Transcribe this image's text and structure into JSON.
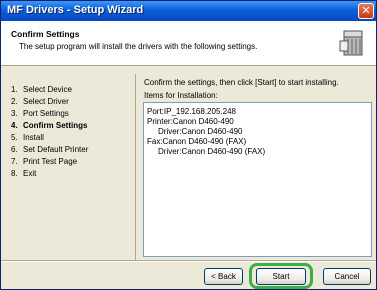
{
  "window": {
    "title": "MF Drivers - Setup Wizard"
  },
  "header": {
    "title": "Confirm Settings",
    "subtitle": "The setup program will install the drivers with the following settings.",
    "icon": "installer-box-icon"
  },
  "steps": [
    {
      "num": "1.",
      "label": "Select Device",
      "active": false
    },
    {
      "num": "2.",
      "label": "Select Driver",
      "active": false
    },
    {
      "num": "3.",
      "label": "Port Settings",
      "active": false
    },
    {
      "num": "4.",
      "label": "Confirm Settings",
      "active": true
    },
    {
      "num": "5.",
      "label": "Install",
      "active": false
    },
    {
      "num": "6.",
      "label": "Set Default Printer",
      "active": false
    },
    {
      "num": "7.",
      "label": "Print Test Page",
      "active": false
    },
    {
      "num": "8.",
      "label": "Exit",
      "active": false
    }
  ],
  "content": {
    "instruction": "Confirm the settings, then click [Start] to start installing.",
    "items_label": "Items for Installation:",
    "items": [
      {
        "text": "Port:IP_192.168.205.248",
        "indent": false
      },
      {
        "text": "Printer:Canon D460-490",
        "indent": false
      },
      {
        "text": "Driver:Canon D460-490",
        "indent": true
      },
      {
        "text": "Fax:Canon D460-490 (FAX)",
        "indent": false
      },
      {
        "text": "Driver:Canon D460-490 (FAX)",
        "indent": true
      }
    ]
  },
  "buttons": {
    "back": "< Back",
    "start": "Start",
    "cancel": "Cancel"
  },
  "colors": {
    "titlebar": "#0a5fd8",
    "highlight": "#3fae49"
  }
}
